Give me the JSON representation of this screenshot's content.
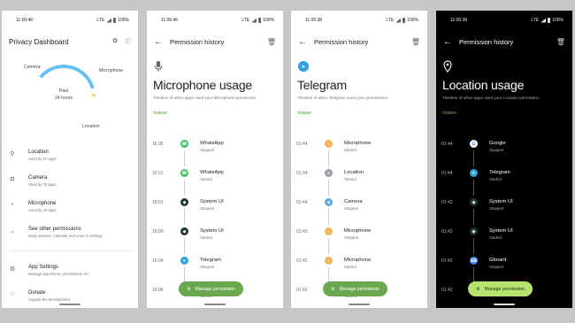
{
  "colors": {
    "green_accent": "#5ba84a",
    "donut_blue": "#68c1f0",
    "donut_yellow": "#f5d07a",
    "donut_green": "#8fd19e",
    "fab_dark": "#b5e36e"
  },
  "status": {
    "time1": "11:00:46",
    "time2": "11:00:46",
    "time3": "11:00:38",
    "time4": "11:00:38",
    "net": "LTE",
    "battery": "100%"
  },
  "dashboard": {
    "title": "Privacy Dashboard",
    "center_line1": "Past",
    "center_line2": "24 hours",
    "label_camera": "Camera",
    "label_microphone": "Microphone",
    "label_location": "Location",
    "items": [
      {
        "icon": "location-pin-icon",
        "title": "Location",
        "sub": "Used by 87 apps"
      },
      {
        "icon": "camera-icon",
        "title": "Camera",
        "sub": "Used by 76 apps"
      },
      {
        "icon": "microphone-icon",
        "title": "Microphone",
        "sub": "Used by 40 apps"
      },
      {
        "icon": "chevron-down-icon",
        "title": "See other permissions",
        "sub": "Body sensors, Calendar and more in settings"
      },
      {
        "icon": "gear-icon",
        "title": "App Settings",
        "sub": "Manage app theme, permissions, etc"
      },
      {
        "icon": "heart-icon",
        "title": "Donate",
        "sub": "Support the development"
      }
    ]
  },
  "mic": {
    "appbar_title": "Permission history",
    "title": "Microphone usage",
    "subtitle": "Timeline of when apps used your Microphone permission",
    "today": "TODAY",
    "fab": "Manage permission",
    "rows": [
      {
        "time": "16:36",
        "name": "WhatsApp",
        "state": "Stopped",
        "color": "#3ec15a",
        "glyph": "☎"
      },
      {
        "time": "16:31",
        "name": "WhatsApp",
        "state": "Started",
        "color": "#3ec15a",
        "glyph": "☎"
      },
      {
        "time": "16:01",
        "name": "System UI",
        "state": "Stopped",
        "color": "#1e3a2b",
        "glyph": "◆"
      },
      {
        "time": "16:00",
        "name": "System UI",
        "state": "Started",
        "color": "#1e3a2b",
        "glyph": "◆"
      },
      {
        "time": "16:06",
        "name": "Telegram",
        "state": "Stopped",
        "color": "#2aa3e0",
        "glyph": "➤"
      },
      {
        "time": "16:06",
        "name": "Telegram",
        "state": "Started",
        "color": "#2aa3e0",
        "glyph": "➤"
      }
    ]
  },
  "telegram": {
    "appbar_title": "Permission history",
    "title": "Telegram",
    "subtitle": "Timeline of when Telegram used your permissions",
    "today": "TODAY",
    "fab": "Manage permission",
    "rows": [
      {
        "time": "01:44",
        "name": "Microphone",
        "state": "Started",
        "color": "#f0b356",
        "glyph": "♪"
      },
      {
        "time": "01:44",
        "name": "Location",
        "state": "Started",
        "color": "#9aa0a6",
        "glyph": "●"
      },
      {
        "time": "01:44",
        "name": "Camera",
        "state": "Stopped",
        "color": "#5aa8e6",
        "glyph": "■"
      },
      {
        "time": "01:43",
        "name": "Microphone",
        "state": "Stopped",
        "color": "#f0b356",
        "glyph": "♪"
      },
      {
        "time": "01:42",
        "name": "Microphone",
        "state": "Started",
        "color": "#f0b356",
        "glyph": "♪"
      },
      {
        "time": "01:42",
        "name": "Microphone",
        "state": "Started",
        "color": "#f0b356",
        "glyph": "♪"
      }
    ]
  },
  "location": {
    "appbar_title": "Permission history",
    "title": "Location usage",
    "subtitle": "Timeline of when apps used your Location permission",
    "today": "TODAY",
    "fab": "Manage permission",
    "rows": [
      {
        "time": "01:44",
        "name": "Google",
        "state": "Stopped",
        "color": "#ffffff",
        "glyph": "G"
      },
      {
        "time": "01:44",
        "name": "Telegram",
        "state": "Started",
        "color": "#2aa3e0",
        "glyph": "➤"
      },
      {
        "time": "01:43",
        "name": "System UI",
        "state": "Stopped",
        "color": "#1e3a2b",
        "glyph": "◆"
      },
      {
        "time": "01:43",
        "name": "System UI",
        "state": "Started",
        "color": "#1e3a2b",
        "glyph": "◆"
      },
      {
        "time": "01:42",
        "name": "Gboard",
        "state": "Stopped",
        "color": "#4a8af4",
        "glyph": "⌨"
      },
      {
        "time": "01:42",
        "name": "",
        "state": "",
        "color": "#4a8af4",
        "glyph": ""
      }
    ]
  }
}
